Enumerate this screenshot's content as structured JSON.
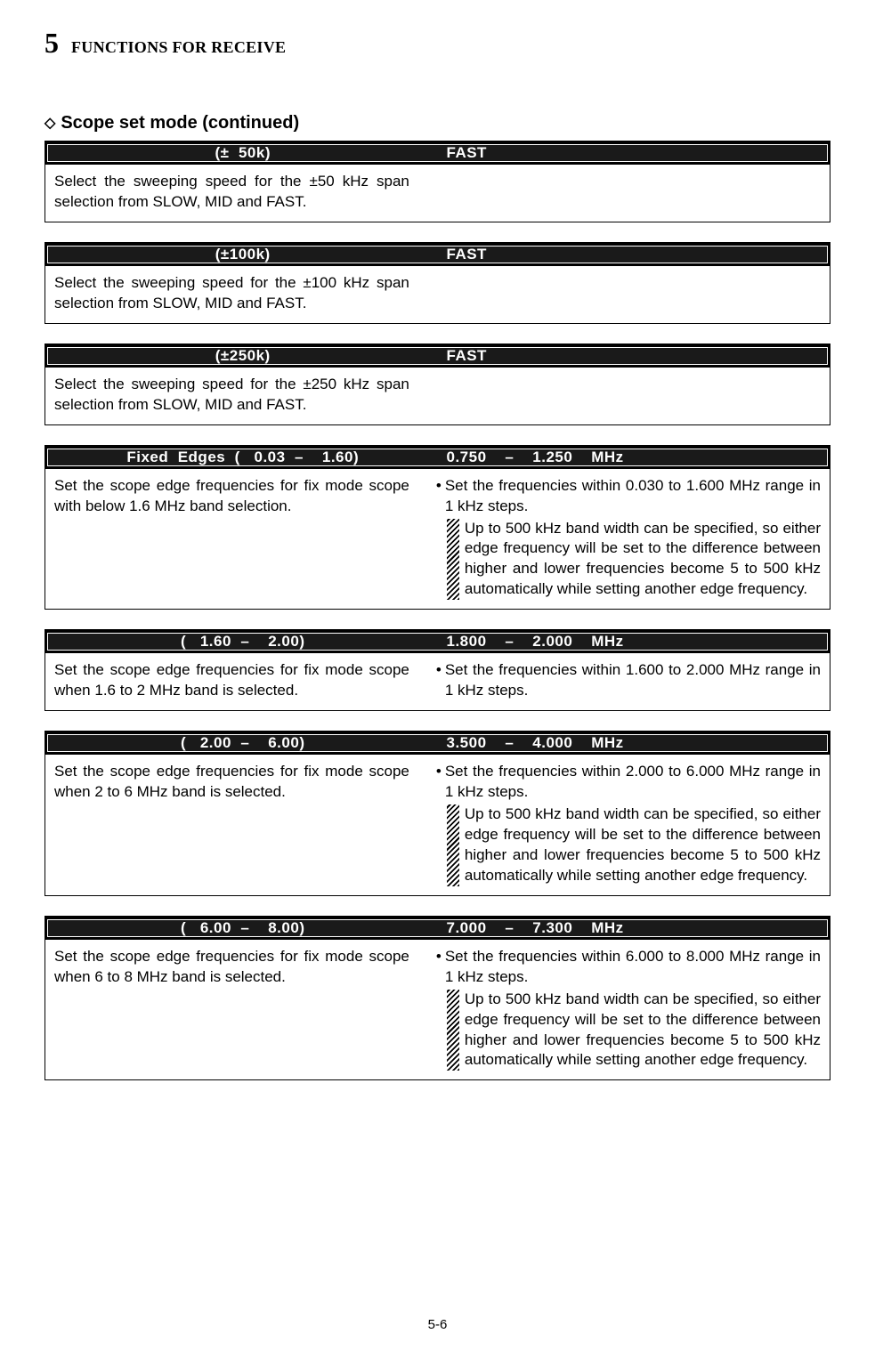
{
  "header": {
    "chapter_number": "5",
    "chapter_title": "FUNCTIONS FOR RECEIVE"
  },
  "section": {
    "diamond": "◇",
    "title": "Scope set mode (continued)"
  },
  "settings": [
    {
      "name": "(±  50k)",
      "value": "FAST",
      "left": "Select the sweeping speed for the ±50 kHz span selection from SLOW, MID and FAST.",
      "bullet": "",
      "note": ""
    },
    {
      "name": "(±100k)",
      "value": "FAST",
      "left": "Select the sweeping speed for the ±100 kHz span selection from SLOW, MID and FAST.",
      "bullet": "",
      "note": ""
    },
    {
      "name": "(±250k)",
      "value": "FAST",
      "left": "Select the sweeping speed for the ±250 kHz span selection from SLOW, MID and FAST.",
      "bullet": "",
      "note": ""
    },
    {
      "name": "Fixed  Edges  (   0.03  –    1.60)",
      "value": "0.750    –    1.250    MHz",
      "left": "Set the scope edge frequencies for fix mode scope with below 1.6 MHz band selection.",
      "bullet": "Set the frequencies within 0.030 to 1.600 MHz range in 1 kHz steps.",
      "note": "Up to 500 kHz band width can be specified, so either edge frequency  will be set to the difference between higher and lower frequencies become 5 to 500 kHz automatically while setting another edge frequency."
    },
    {
      "name": "(   1.60  –    2.00)",
      "value": "1.800    –    2.000    MHz",
      "left": "Set the scope edge frequencies for fix mode scope when 1.6 to 2 MHz band is selected.",
      "bullet": "Set the frequencies within 1.600 to 2.000 MHz range in 1 kHz steps.",
      "note": ""
    },
    {
      "name": "(   2.00  –    6.00)",
      "value": "3.500    –    4.000    MHz",
      "left": "Set the scope edge frequencies for fix mode scope when 2 to 6 MHz band is selected.",
      "bullet": "Set the frequencies within 2.000 to 6.000 MHz range in 1 kHz steps.",
      "note": "Up to 500 kHz band width can be specified, so either edge frequency  will be set to the difference between higher and lower frequencies become 5 to 500 kHz automatically while setting another edge frequency."
    },
    {
      "name": "(   6.00  –    8.00)",
      "value": "7.000    –    7.300    MHz",
      "left": "Set the scope edge frequencies for fix mode scope when 6 to 8 MHz band is selected.",
      "bullet": "Set the frequencies within 6.000 to 8.000 MHz range in 1 kHz steps.",
      "note": "Up to 500 kHz band width can be specified, so either edge frequency  will be set to the difference between higher and lower frequencies become 5 to 500 kHz automatically while setting another edge frequency."
    }
  ],
  "footer": {
    "page": "5-6"
  }
}
